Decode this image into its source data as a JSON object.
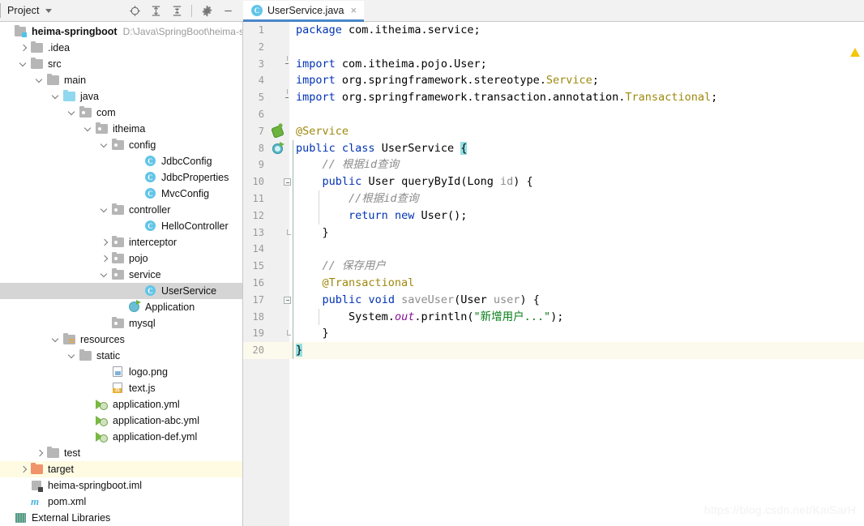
{
  "toolbar": {
    "panel_title": "Project",
    "icons": [
      {
        "name": "locate-icon",
        "glyph": "locate"
      },
      {
        "name": "expand-all-icon",
        "glyph": "expand"
      },
      {
        "name": "collapse-all-icon",
        "glyph": "collapse"
      },
      {
        "name": "settings-gear-icon",
        "glyph": "gear"
      },
      {
        "name": "hide-panel-icon",
        "glyph": "minus"
      }
    ]
  },
  "tabs": [
    {
      "label": "UserService.java",
      "icon": "class-icon",
      "icon_letter": "C",
      "close": "×",
      "active": true
    }
  ],
  "tree": {
    "root": {
      "label": "heima-springboot",
      "path": "D:\\Java\\SpringBoot\\heima-s"
    },
    "items": [
      {
        "label": "heima-springboot",
        "path": "D:\\Java\\SpringBoot\\heima-s",
        "indent": 0,
        "arrow": "none",
        "icon": "module-icon",
        "bold": true,
        "state": "normal"
      },
      {
        "label": ".idea",
        "indent": 1,
        "arrow": "right",
        "icon": "folder-icon",
        "bold": false,
        "state": "normal"
      },
      {
        "label": "src",
        "indent": 1,
        "arrow": "down",
        "icon": "folder-icon",
        "bold": false,
        "state": "normal"
      },
      {
        "label": "main",
        "indent": 2,
        "arrow": "down",
        "icon": "folder-icon",
        "bold": false,
        "state": "normal"
      },
      {
        "label": "java",
        "indent": 3,
        "arrow": "down",
        "icon": "source-root-icon",
        "bold": false,
        "state": "normal"
      },
      {
        "label": "com",
        "indent": 4,
        "arrow": "down",
        "icon": "package-icon",
        "bold": false,
        "state": "normal"
      },
      {
        "label": "itheima",
        "indent": 5,
        "arrow": "down",
        "icon": "package-icon",
        "bold": false,
        "state": "normal"
      },
      {
        "label": "config",
        "indent": 6,
        "arrow": "down",
        "icon": "package-icon",
        "bold": false,
        "state": "normal"
      },
      {
        "label": "JdbcConfig",
        "indent": 8,
        "arrow": "none",
        "icon": "class-icon",
        "bold": false,
        "state": "normal"
      },
      {
        "label": "JdbcProperties",
        "indent": 8,
        "arrow": "none",
        "icon": "class-icon",
        "bold": false,
        "state": "normal"
      },
      {
        "label": "MvcConfig",
        "indent": 8,
        "arrow": "none",
        "icon": "class-icon",
        "bold": false,
        "state": "normal"
      },
      {
        "label": "controller",
        "indent": 6,
        "arrow": "down",
        "icon": "package-icon",
        "bold": false,
        "state": "normal"
      },
      {
        "label": "HelloController",
        "indent": 8,
        "arrow": "none",
        "icon": "class-icon",
        "bold": false,
        "state": "normal"
      },
      {
        "label": "interceptor",
        "indent": 6,
        "arrow": "right",
        "icon": "package-icon",
        "bold": false,
        "state": "normal"
      },
      {
        "label": "pojo",
        "indent": 6,
        "arrow": "right",
        "icon": "package-icon",
        "bold": false,
        "state": "normal"
      },
      {
        "label": "service",
        "indent": 6,
        "arrow": "down",
        "icon": "package-icon",
        "bold": false,
        "state": "normal"
      },
      {
        "label": "UserService",
        "indent": 8,
        "arrow": "none",
        "icon": "class-icon",
        "bold": false,
        "state": "selected"
      },
      {
        "label": "Application",
        "indent": 7,
        "arrow": "none",
        "icon": "spring-app-icon",
        "bold": false,
        "state": "normal"
      },
      {
        "label": "mysql",
        "indent": 6,
        "arrow": "none",
        "icon": "package-icon",
        "bold": false,
        "state": "normal"
      },
      {
        "label": "resources",
        "indent": 3,
        "arrow": "down",
        "icon": "resource-root-icon",
        "bold": false,
        "state": "normal"
      },
      {
        "label": "static",
        "indent": 4,
        "arrow": "down",
        "icon": "folder-icon",
        "bold": false,
        "state": "normal"
      },
      {
        "label": "logo.png",
        "indent": 6,
        "arrow": "none",
        "icon": "image-file-icon",
        "bold": false,
        "state": "normal"
      },
      {
        "label": "text.js",
        "indent": 6,
        "arrow": "none",
        "icon": "js-file-icon",
        "bold": false,
        "state": "normal"
      },
      {
        "label": "application.yml",
        "indent": 5,
        "arrow": "none",
        "icon": "yml-file-icon",
        "bold": false,
        "state": "normal"
      },
      {
        "label": "application-abc.yml",
        "indent": 5,
        "arrow": "none",
        "icon": "yml-file-icon",
        "bold": false,
        "state": "normal"
      },
      {
        "label": "application-def.yml",
        "indent": 5,
        "arrow": "none",
        "icon": "yml-file-icon",
        "bold": false,
        "state": "normal"
      },
      {
        "label": "test",
        "indent": 2,
        "arrow": "right",
        "icon": "folder-icon",
        "bold": false,
        "state": "normal"
      },
      {
        "label": "target",
        "indent": 1,
        "arrow": "right",
        "icon": "target-folder-icon",
        "bold": false,
        "state": "highlighted"
      },
      {
        "label": "heima-springboot.iml",
        "indent": 1,
        "arrow": "none",
        "icon": "iml-file-icon",
        "bold": false,
        "state": "normal"
      },
      {
        "label": "pom.xml",
        "indent": 1,
        "arrow": "none",
        "icon": "maven-file-icon",
        "bold": false,
        "state": "normal"
      },
      {
        "label": "External Libraries",
        "indent": 0,
        "arrow": "none",
        "icon": "external-libraries-icon",
        "bold": false,
        "state": "normal"
      }
    ]
  },
  "editor": {
    "file": "UserService.java",
    "current_line": 20,
    "line_numbers": [
      1,
      2,
      3,
      4,
      5,
      6,
      7,
      8,
      9,
      10,
      11,
      12,
      13,
      14,
      15,
      16,
      17,
      18,
      19,
      20
    ],
    "lines": [
      {
        "n": 1,
        "code": "package com.itheima.service;"
      },
      {
        "n": 2,
        "code": ""
      },
      {
        "n": 3,
        "code": "import com.itheima.pojo.User;"
      },
      {
        "n": 4,
        "code": "import org.springframework.stereotype.Service;"
      },
      {
        "n": 5,
        "code": "import org.springframework.transaction.annotation.Transactional;"
      },
      {
        "n": 6,
        "code": ""
      },
      {
        "n": 7,
        "code": "@Service"
      },
      {
        "n": 8,
        "code": "public class UserService {"
      },
      {
        "n": 9,
        "code": "    // 根据id查询"
      },
      {
        "n": 10,
        "code": "    public User queryById(Long id) {"
      },
      {
        "n": 11,
        "code": "        //根据id查询"
      },
      {
        "n": 12,
        "code": "        return new User();"
      },
      {
        "n": 13,
        "code": "    }"
      },
      {
        "n": 14,
        "code": ""
      },
      {
        "n": 15,
        "code": "    // 保存用户"
      },
      {
        "n": 16,
        "code": "    @Transactional"
      },
      {
        "n": 17,
        "code": "    public void saveUser(User user) {"
      },
      {
        "n": 18,
        "code": "        System.out.println(\"新增用户...\");"
      },
      {
        "n": 19,
        "code": "    }"
      },
      {
        "n": 20,
        "code": "}"
      }
    ],
    "gutter_markers": [
      {
        "line": 7,
        "name": "spring-bean-gutter-icon"
      },
      {
        "line": 8,
        "name": "spring-bean-class-gutter-icon"
      }
    ],
    "inspection_marker": {
      "name": "warning-marker",
      "color": "#f4c60a",
      "count": 1
    }
  },
  "watermark": "https://blog.csdn.net/KaiSarH",
  "colors": {
    "keyword": "#0033b3",
    "annotation": "#9e880d",
    "string": "#067d17",
    "comment": "#8c8c8c",
    "field": "#871094",
    "param": "#8c8c8c",
    "tab_underline": "#4a86c8",
    "selection": "#d5d5d5",
    "caret_line": "#fcf9ed",
    "target_highlight": "#fffbe2",
    "brace_match": "#93e0e3"
  }
}
